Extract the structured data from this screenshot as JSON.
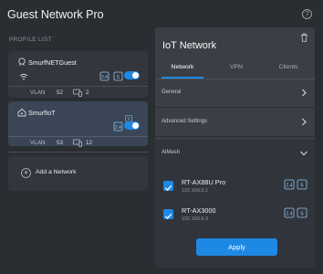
{
  "app": {
    "title": "Guest Network Pro",
    "help_glyph": "?"
  },
  "profile_list": {
    "label": "PROFILE LIST",
    "profiles": [
      {
        "name": "SmurfNETGuest",
        "icon": "guest-wifi-icon",
        "bands": [
          "2.4",
          "5"
        ],
        "enabled": true,
        "vlan_label": "VLAN",
        "vlan": "52",
        "devices": "2",
        "selected": false
      },
      {
        "name": "SmurfIoT",
        "icon": "iot-home-icon",
        "bands": [
          "2.4",
          "5"
        ],
        "enabled": true,
        "vlan_label": "VLAN",
        "vlan": "53",
        "devices": "12",
        "selected": true
      }
    ],
    "add_label": "Add a Network",
    "add_glyph": "+"
  },
  "detail": {
    "title": "IoT Network",
    "tabs": [
      {
        "label": "Network",
        "active": true
      },
      {
        "label": "VPN",
        "active": false
      },
      {
        "label": "Clients",
        "active": false
      }
    ],
    "sections": {
      "general": "General",
      "advanced": "Advanced Settings",
      "aimesh": "AiMesh"
    },
    "nodes": [
      {
        "name": "RT-AX88U Pro",
        "ip": "192.168.9.1",
        "checked": true,
        "bands": [
          "2.4",
          "5"
        ]
      },
      {
        "name": "RT-AX3000",
        "ip": "192.168.9.3",
        "checked": true,
        "bands": [
          "2.4",
          "5"
        ]
      }
    ],
    "apply_label": "Apply"
  },
  "colors": {
    "accent": "#1e88e5",
    "background": "#2a2d32",
    "panel": "#3b3f45",
    "selected_card": "#3a4656"
  }
}
